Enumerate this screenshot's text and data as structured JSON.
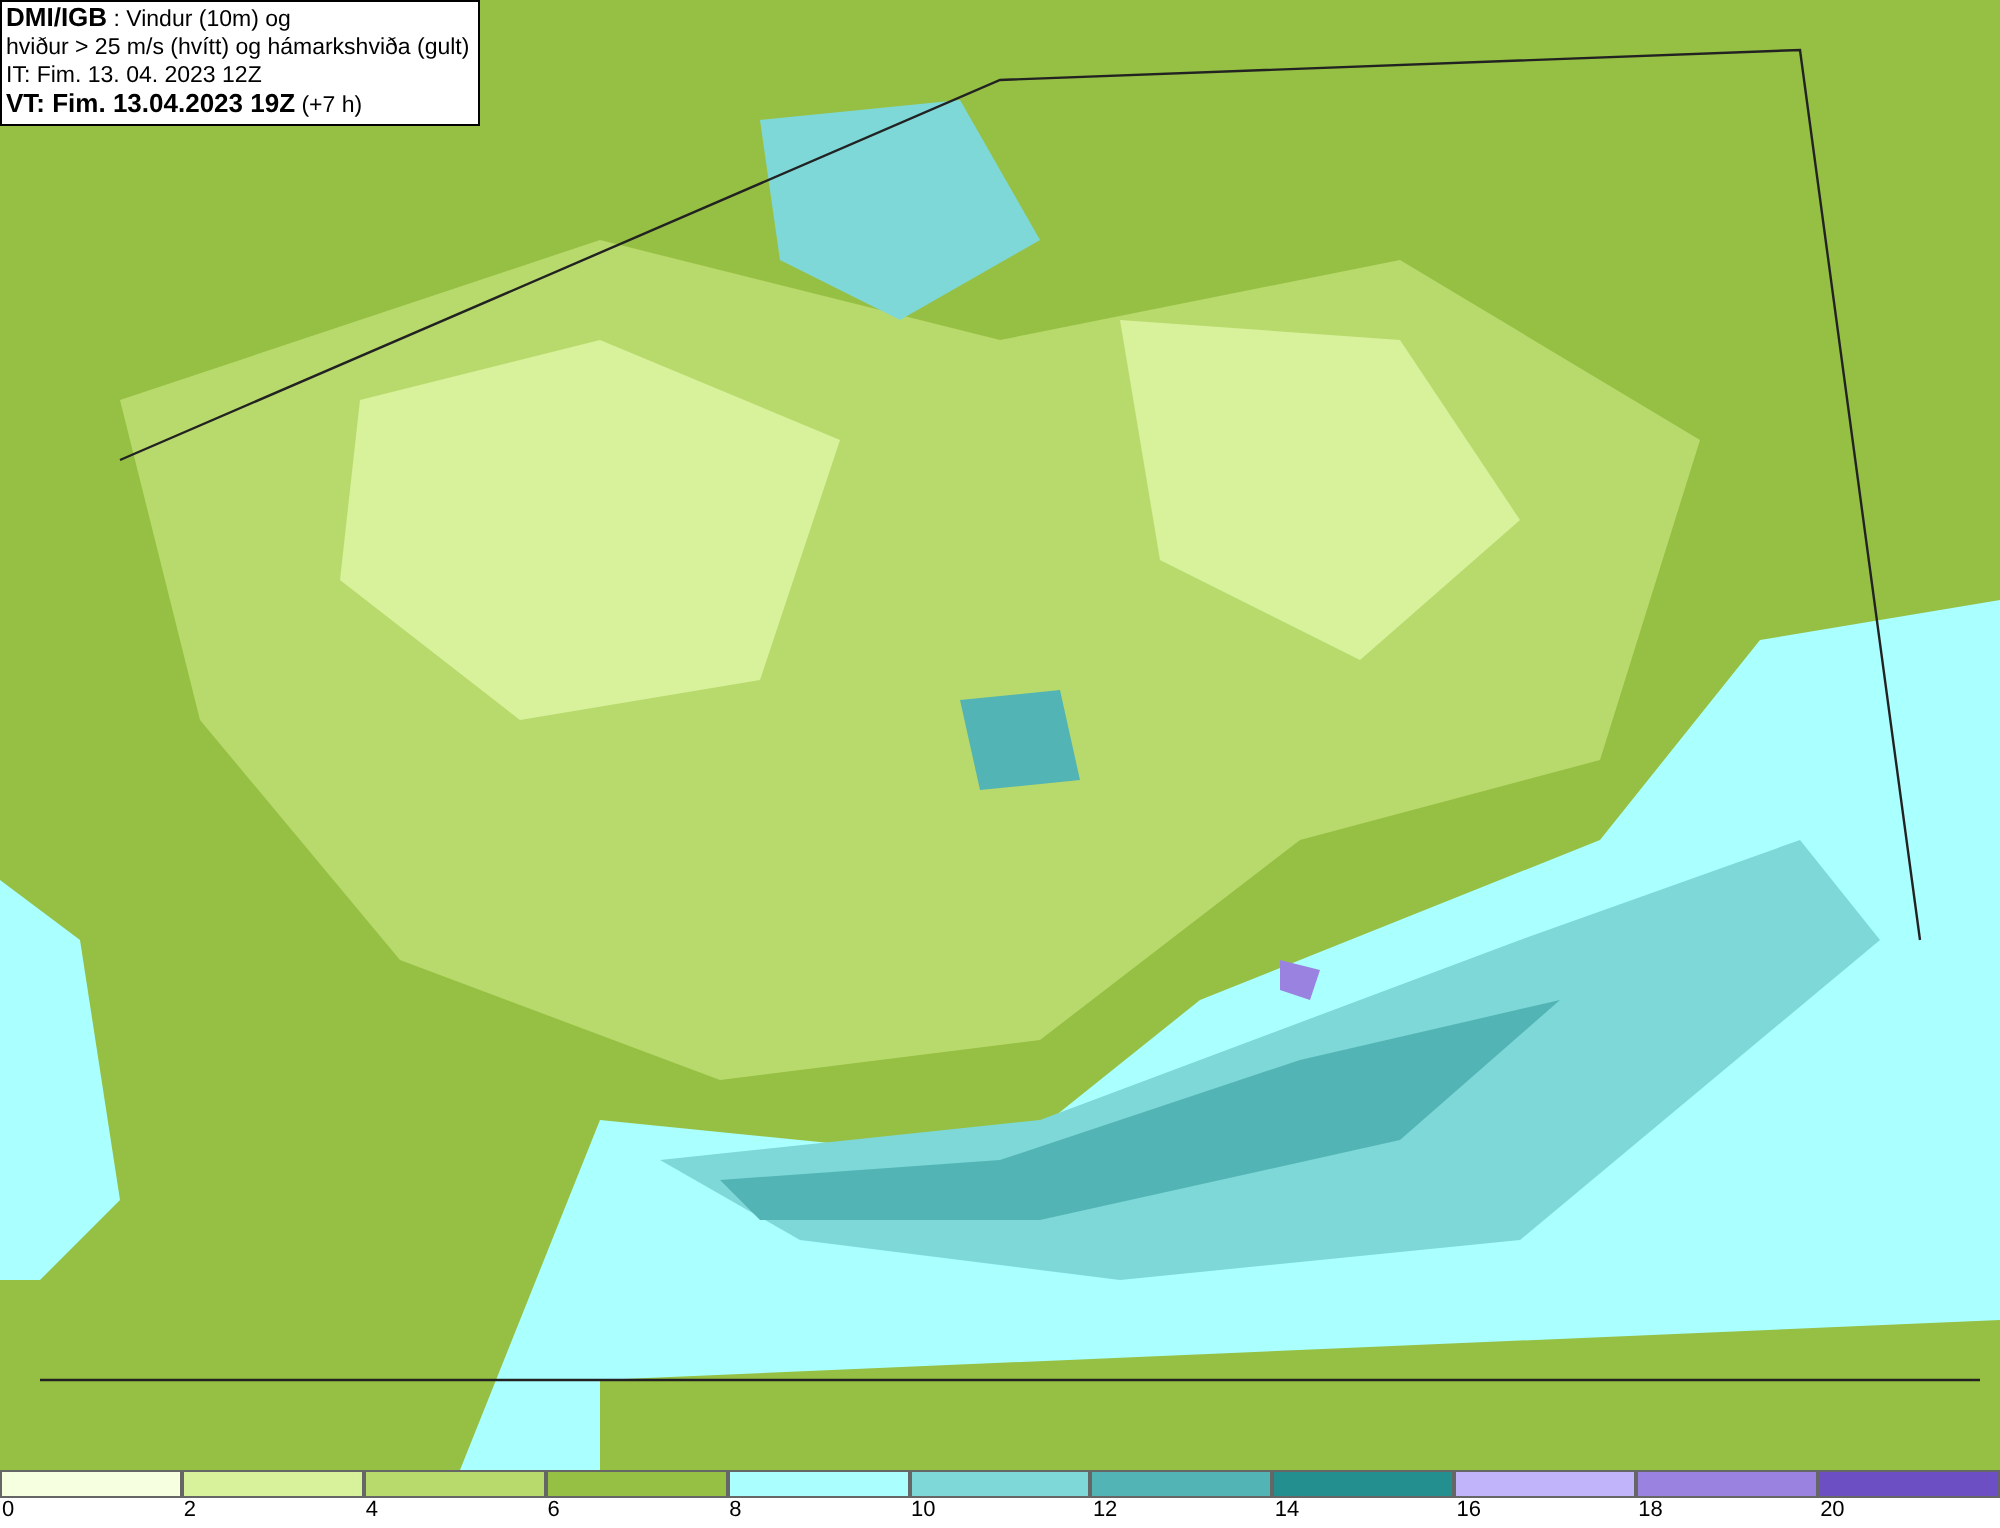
{
  "title_box": {
    "lines": [
      "**DMI/IGB** : Vindur (10m) og",
      "hviður > 25 m/s (hvítt) og hámarkshviða (gult)",
      "IT: Fim. 13. 04. 2023 12Z",
      "**VT: Fim. 13.04.2023 19Z** (+7 h)"
    ]
  },
  "legend": {
    "bins": [
      {
        "label": "0",
        "color": "#f6ffdf"
      },
      {
        "label": "2",
        "color": "#d8f29c"
      },
      {
        "label": "4",
        "color": "#b8da6c"
      },
      {
        "label": "6",
        "color": "#96c043"
      },
      {
        "label": "8",
        "color": "#aafffe"
      },
      {
        "label": "10",
        "color": "#7ed8d8"
      },
      {
        "label": "12",
        "color": "#52b4b4"
      },
      {
        "label": "14",
        "color": "#238f8f"
      },
      {
        "label": "16",
        "color": "#c2b4fa"
      },
      {
        "label": "18",
        "color": "#9a83e0"
      },
      {
        "label": "20",
        "color": "#6c4fc3"
      }
    ]
  }
}
